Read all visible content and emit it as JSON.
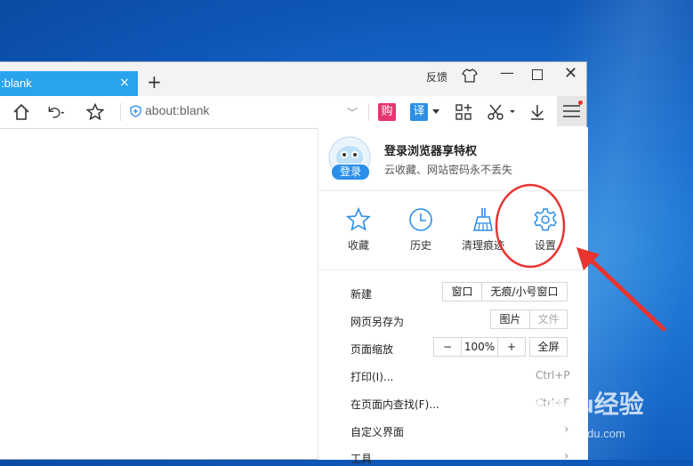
{
  "browser": {
    "tab_title": ":blank",
    "tab_close": "×",
    "new_tab": "+",
    "feedback": "反馈",
    "minimize": "—",
    "close": "✕",
    "address": "about:blank",
    "address_dropdown": "﹀",
    "buy_label": "购",
    "translate_label": "译"
  },
  "menu": {
    "login_badge": "登录",
    "login_title": "登录浏览器享特权",
    "login_subtitle": "云收藏、网站密码永不丢失",
    "quick_actions": [
      {
        "label": "收藏",
        "icon": "star-icon"
      },
      {
        "label": "历史",
        "icon": "clock-icon"
      },
      {
        "label": "清理痕迹",
        "icon": "broom-icon"
      },
      {
        "label": "设置",
        "icon": "gear-icon"
      }
    ],
    "new_label": "新建",
    "new_window": "窗口",
    "new_private": "无痕/小号窗口",
    "save_as_label": "网页另存为",
    "save_image": "图片",
    "save_file": "文件",
    "zoom_label": "页面缩放",
    "zoom_minus": "−",
    "zoom_value": "100%",
    "zoom_plus": "+",
    "fullscreen": "全屏",
    "print_label": "打印(I)...",
    "print_shortcut": "Ctrl+P",
    "find_label": "在页面内查找(F)...",
    "find_shortcut": "Ctrl+F",
    "customize_label": "自定义界面",
    "tools_label": "工具",
    "chevron": "›"
  },
  "watermark": {
    "brand": "Baidu经验",
    "url": "jingyan.baidu.com"
  },
  "colors": {
    "tab_active": "#2aa3ef",
    "buy_badge": "#e8336e",
    "translate_badge": "#2b8fe8",
    "annotation_red": "#e8332f"
  }
}
